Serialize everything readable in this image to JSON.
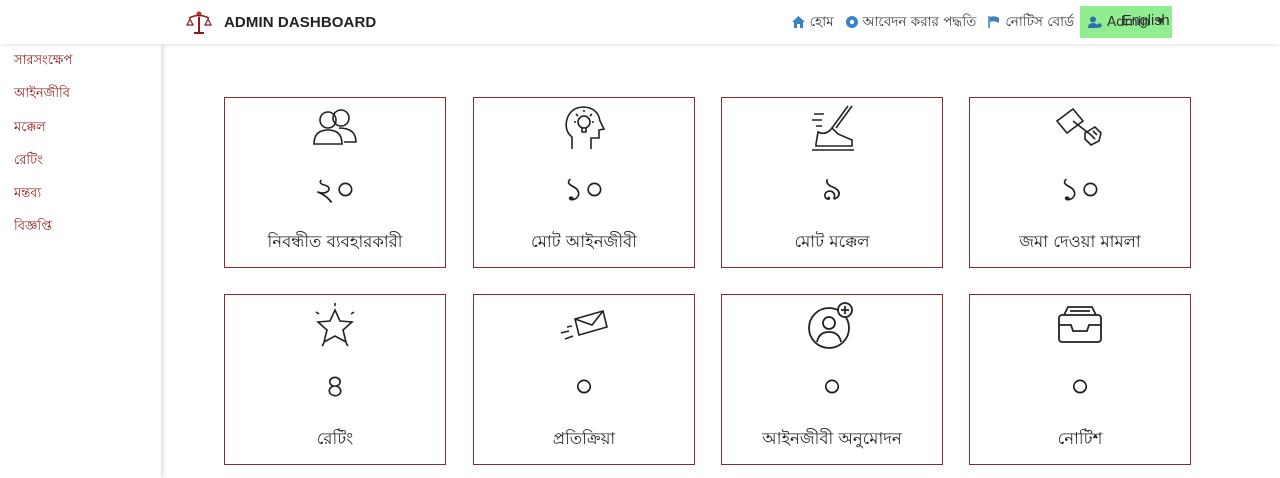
{
  "header": {
    "title": "ADMIN DASHBOARD",
    "nav": {
      "home": "হোম",
      "apply": "আবেদন করার পদ্ধতি",
      "notice_board": "নোটিস বোর্ড",
      "admin": "Admin",
      "language": "English"
    },
    "colors": {
      "admin_bg": "#90ee90",
      "nav_icon": "#3b82c4"
    }
  },
  "sidebar": {
    "items": [
      {
        "label": "সারসংক্ষেপ"
      },
      {
        "label": "আইনজীবি"
      },
      {
        "label": "মক্কেল"
      },
      {
        "label": "রেটিং"
      },
      {
        "label": "মন্তব্য"
      },
      {
        "label": "বিজ্ঞপ্তি"
      }
    ],
    "color": "#8b1a1a"
  },
  "cards": [
    {
      "icon": "users-icon",
      "count": "২০",
      "label": "নিবন্ধীত ব্যবহারকারী"
    },
    {
      "icon": "idea-head-icon",
      "count": "১০",
      "label": "মোট আইনজীবী"
    },
    {
      "icon": "running-shoe-icon",
      "count": "৯",
      "label": "মোট মক্কেল"
    },
    {
      "icon": "flag-hand-icon",
      "count": "১০",
      "label": "জমা দেওয়া মামলা"
    },
    {
      "icon": "star-icon",
      "count": "৪",
      "label": "রেটিং"
    },
    {
      "icon": "envelope-icon",
      "count": "০",
      "label": "প্রতিক্রিয়া"
    },
    {
      "icon": "user-add-icon",
      "count": "০",
      "label": "আইনজীবী অনুমোদন"
    },
    {
      "icon": "inbox-icon",
      "count": "০",
      "label": "নোটিশ"
    }
  ]
}
